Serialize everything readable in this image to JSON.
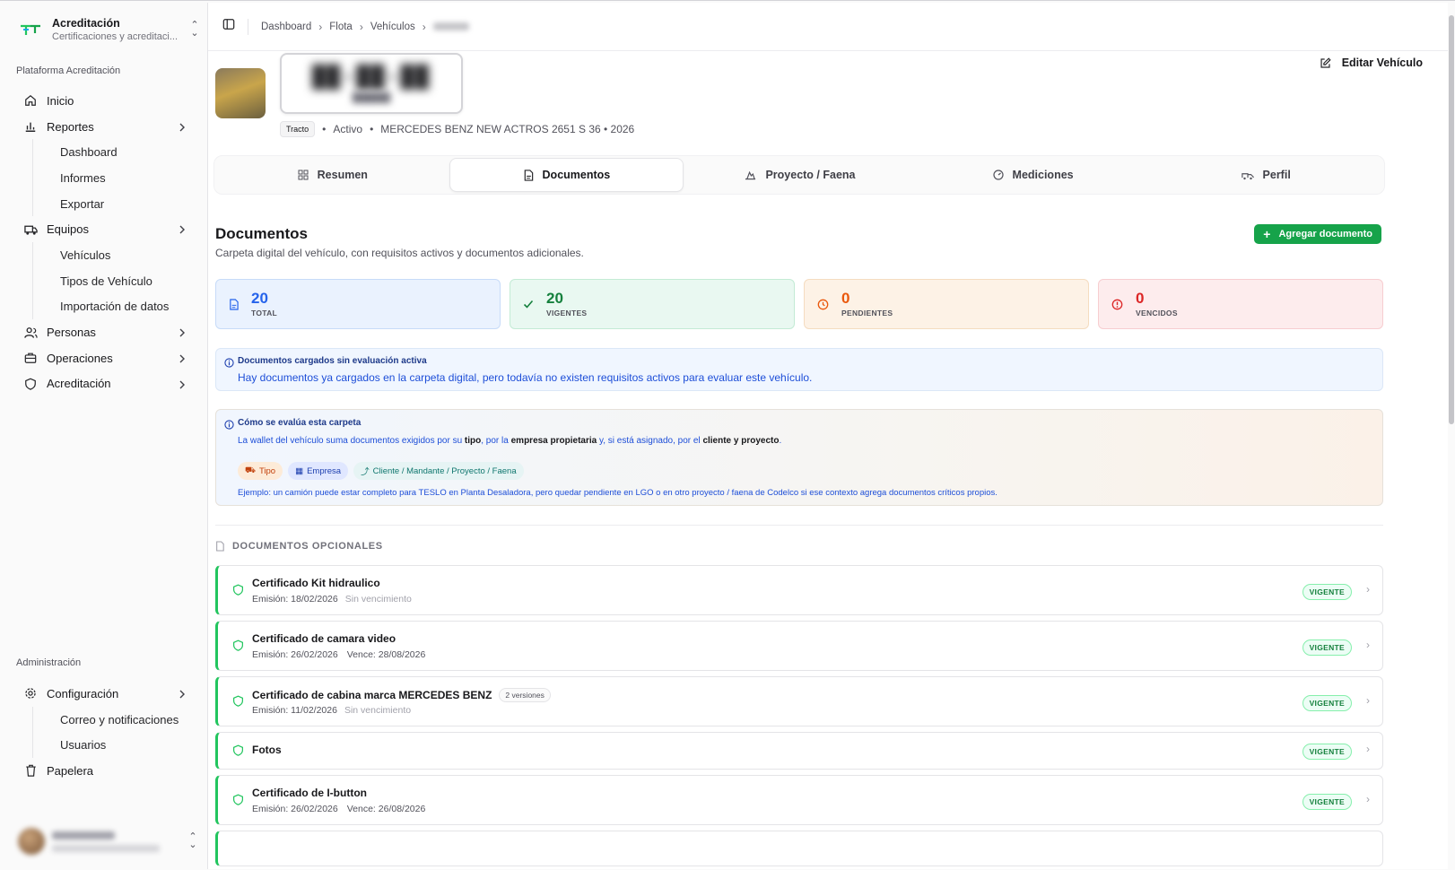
{
  "brand": {
    "title": "Acreditación",
    "subtitle": "Certificaciones y acreditaci..."
  },
  "sidebar": {
    "group1": "Plataforma Acreditación",
    "items": [
      {
        "label": "Inicio",
        "icon": "home-icon"
      },
      {
        "label": "Reportes",
        "icon": "chart-icon",
        "children": [
          "Dashboard",
          "Informes",
          "Exportar"
        ]
      },
      {
        "label": "Equipos",
        "icon": "truck-icon",
        "children": [
          "Vehículos",
          "Tipos de Vehículo",
          "Importación de datos"
        ]
      },
      {
        "label": "Personas",
        "icon": "users-icon"
      },
      {
        "label": "Operaciones",
        "icon": "briefcase-icon"
      },
      {
        "label": "Acreditación",
        "icon": "shield-icon"
      }
    ],
    "group2": "Administración",
    "admin": [
      {
        "label": "Configuración",
        "icon": "gear-icon",
        "children": [
          "Correo y notificaciones",
          "Usuarios"
        ]
      },
      {
        "label": "Papelera",
        "icon": "trash-icon"
      }
    ]
  },
  "breadcrumb": [
    "Dashboard",
    "Flota",
    "Vehículos"
  ],
  "vehicle": {
    "type_tag": "Tracto",
    "status": "Activo",
    "model": "MERCEDES BENZ NEW ACTROS 2651 S 36 • 2026",
    "edit_label": "Editar Vehículo"
  },
  "tabs": [
    {
      "label": "Resumen",
      "icon": "grid-icon"
    },
    {
      "label": "Documentos",
      "icon": "document-icon",
      "active": true
    },
    {
      "label": "Proyecto / Faena",
      "icon": "mine-icon"
    },
    {
      "label": "Mediciones",
      "icon": "gauge-icon"
    },
    {
      "label": "Perfil",
      "icon": "truck-outline-icon"
    }
  ],
  "documents": {
    "title": "Documentos",
    "subtitle": "Carpeta digital del vehículo, con requisitos activos y documentos adicionales.",
    "add_label": "Agregar documento",
    "stats": [
      {
        "value": "20",
        "label": "TOTAL",
        "color": "#2563eb"
      },
      {
        "value": "20",
        "label": "VIGENTES",
        "color": "#15803d"
      },
      {
        "value": "0",
        "label": "PENDIENTES",
        "color": "#ea580c"
      },
      {
        "value": "0",
        "label": "VENCIDOS",
        "color": "#dc2626"
      }
    ],
    "notice": {
      "title": "Documentos cargados sin evaluación activa",
      "text": "Hay documentos ya cargados en la carpeta digital, pero todavía no existen requisitos activos para evaluar este vehículo."
    },
    "howto": {
      "title": "Cómo se evalúa esta carpeta",
      "t1": "La wallet del vehículo suma documentos exigidos por su ",
      "b1": "tipo",
      "t2": ", por la ",
      "b2": "empresa propietaria",
      "t3": " y, si está asignado, por el ",
      "b3": "cliente y proyecto",
      "t4": ".",
      "chips": [
        "Tipo",
        "Empresa",
        "Cliente / Mandante / Proyecto / Faena"
      ],
      "example": "Ejemplo: un camión puede estar completo para TESLO en Planta Desaladora, pero quedar pendiente en LGO o en otro proyecto / faena de Codelco si ese contexto agrega documentos críticos propios."
    },
    "optional_title": "DOCUMENTOS OPCIONALES",
    "items": [
      {
        "name": "Certificado Kit hidraulico",
        "issued": "Emisión: 18/02/2026",
        "expiry": "Sin vencimiento",
        "status": "VIGENTE"
      },
      {
        "name": "Certificado de camara video",
        "issued": "Emisión: 26/02/2026",
        "expiry": "Vence: 28/08/2026",
        "status": "VIGENTE"
      },
      {
        "name": "Certificado de cabina marca MERCEDES BENZ",
        "versions": "2 versiones",
        "issued": "Emisión: 11/02/2026",
        "expiry": "Sin vencimiento",
        "status": "VIGENTE"
      },
      {
        "name": "Fotos",
        "status": "VIGENTE"
      },
      {
        "name": "Certificado de I-button",
        "issued": "Emisión: 26/02/2026",
        "expiry": "Vence: 26/08/2026",
        "status": "VIGENTE"
      }
    ]
  }
}
